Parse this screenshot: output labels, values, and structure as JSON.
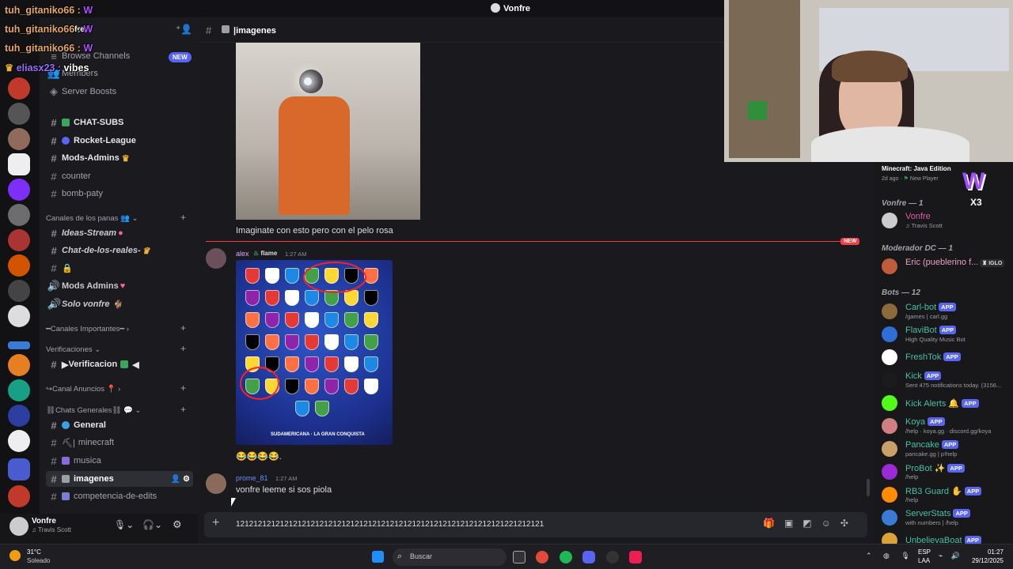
{
  "window": {
    "title": "Vonfre"
  },
  "overlay": {
    "lines": [
      {
        "user": "tuh_gitaniko66 :",
        "msg": "W"
      },
      {
        "user": "tuh_gitaniko66 :",
        "msg": "W"
      },
      {
        "user": "tuh_gitaniko66 :",
        "msg": "W"
      },
      {
        "user": "eliasx23 :",
        "msg": "vibes"
      }
    ]
  },
  "sidebar": {
    "server_name_partial": "fre",
    "top_items": [
      {
        "label": "Browse Channels",
        "badge": "NEW"
      },
      {
        "label": "Members"
      },
      {
        "label": "Server Boosts"
      }
    ],
    "channels_a": [
      {
        "label": "CHAT-SUBS"
      },
      {
        "label": "Rocket-League"
      },
      {
        "label": "Mods-Admins"
      },
      {
        "label": "counter"
      },
      {
        "label": "bomb-paty"
      }
    ],
    "cat_panas": "Canales de los panas",
    "channels_b": [
      {
        "label": "Ideas-Stream"
      },
      {
        "label": "Chat-de-los-reales-"
      },
      {
        "label": ""
      },
      {
        "label": "Mods Admins"
      },
      {
        "label": "Solo vonfre"
      }
    ],
    "cat_importantes": "Canales Importantes",
    "cat_verificaciones": "Verificaciones",
    "verificacion": "Verificacion",
    "cat_anuncios": "Canal Anuncios",
    "cat_generales": "Chats Generales",
    "channels_c": [
      {
        "label": "General"
      },
      {
        "label": "minecraft"
      },
      {
        "label": "musica"
      },
      {
        "label": "imagenes"
      },
      {
        "label": "competencia-de-edits"
      }
    ]
  },
  "user_panel": {
    "name": "Vonfre",
    "status": "Travis Scott"
  },
  "channel": {
    "name": "imagenes"
  },
  "messages": {
    "caption": "Imaginate con esto pero con el pelo rosa",
    "new_label": "NEW",
    "alex": {
      "name": "alex",
      "tag": "flame",
      "time": "1:27 AM",
      "text": "😂😂😂😂."
    },
    "image_caption": "SUDAMERICANA · LA GRAN CONQUISTA",
    "prome": {
      "name": "prome_81",
      "time": "1:27 AM",
      "text": "vonfre leeme si sos piola"
    }
  },
  "composer": {
    "text": "1212121212121212121212121212121212121212121212121212121212121221212121"
  },
  "members": {
    "activity": {
      "game": "Minecraft: Java Edition",
      "meta": "2d ago",
      "role": "New Player"
    },
    "groups": [
      {
        "label": "Vonfre — 1"
      },
      {
        "label": "Moderador DC — 1"
      },
      {
        "label": "Bots — 12"
      }
    ],
    "vonfre": {
      "name": "Vonfre",
      "sub": "Travis Scott"
    },
    "mod": {
      "name": "Eric (pueblerino f...",
      "tag": "IGLO"
    },
    "bots": [
      {
        "name": "Carl-bot",
        "sub": "/games | carl.gg"
      },
      {
        "name": "FlaviBot",
        "sub": "High Quality Music Bot"
      },
      {
        "name": "FreshTok",
        "sub": ""
      },
      {
        "name": "Kick",
        "sub": "Sent 475 notifications today. (3156..."
      },
      {
        "name": "Kick Alerts",
        "sub": ""
      },
      {
        "name": "Koya",
        "sub": "/help · koya.gg · discord.gg/koya"
      },
      {
        "name": "Pancake",
        "sub": "pancake.gg | p!help"
      },
      {
        "name": "ProBot",
        "sub": "/help"
      },
      {
        "name": "RB3 Guard",
        "sub": "/help"
      },
      {
        "name": "ServerStats",
        "sub": "with numbers | /help"
      },
      {
        "name": "UnbelievaBoat",
        "sub": ""
      }
    ],
    "app_label": "APP"
  },
  "webcam": {
    "badge": "W",
    "badge_count": "X3"
  },
  "taskbar": {
    "weather_temp": "31°C",
    "weather_desc": "Soleado",
    "search": "Buscar",
    "lang1": "ESP",
    "lang2": "LAA",
    "time": "01:27",
    "date": "29/12/2025"
  },
  "colors": {
    "accent": "#5865f2",
    "online": "#23a55a",
    "new_line": "#f23f43"
  }
}
